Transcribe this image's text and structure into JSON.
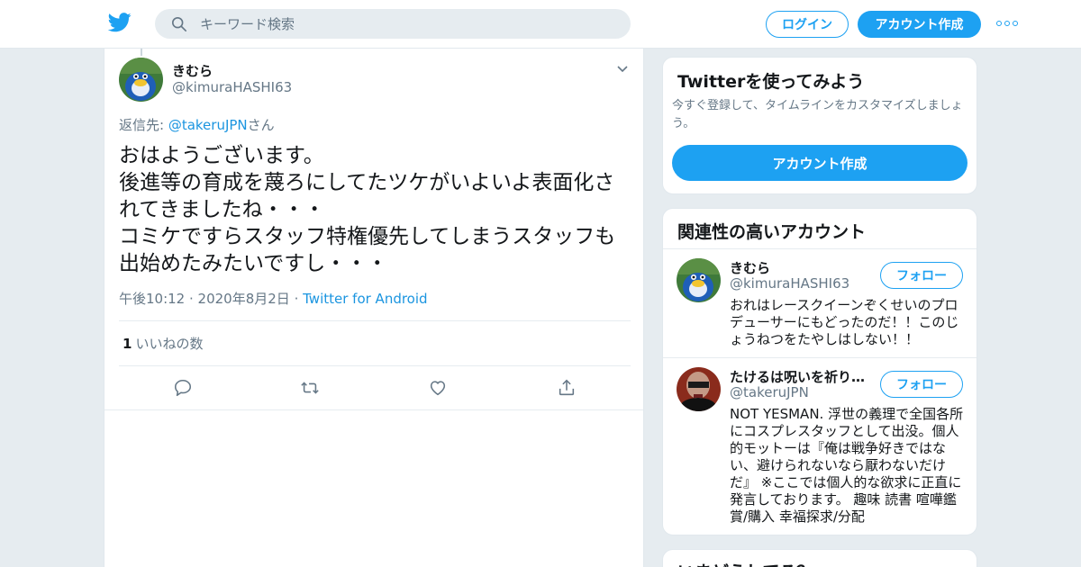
{
  "header": {
    "search_placeholder": "キーワード検索",
    "login_label": "ログイン",
    "signup_label": "アカウント作成",
    "brand_color": "#1da1f2",
    "icons": [
      "twitter-bird-icon",
      "search-icon",
      "more-icon"
    ]
  },
  "tweet": {
    "display_name": "きむら",
    "handle": "@kimuraHASHI63",
    "reply_prefix": "返信先: ",
    "reply_mention": "@takeruJPN",
    "reply_suffix": "さん",
    "text": "おはようございます。\n後進等の育成を蔑ろにしてたツケがいよいよ表面化されてきましたね・・・\nコミケですらスタッフ特権優先してしまうスタッフも出始めたみたいですし・・・",
    "time": "午後10:12",
    "date": "2020年8月2日",
    "source": "Twitter for Android",
    "like_count": "1",
    "like_label": "いいねの数",
    "actions": [
      "reply-icon",
      "retweet-icon",
      "like-icon",
      "share-icon"
    ]
  },
  "signup_card": {
    "title": "Twitterを使ってみよう",
    "description": "今すぐ登録して、タイムラインをカスタマイズしましょう。",
    "button_label": "アカウント作成"
  },
  "related": {
    "title": "関連性の高いアカウント",
    "accounts": [
      {
        "name": "きむら",
        "handle": "@kimuraHASHI63",
        "bio": "おれはレースクイーンぞくせいのプロデューサーにもどったのだ！！このじょうねつをたやしはしない！！",
        "follow_label": "フォロー"
      },
      {
        "name": "たけるは呪いを祈り…",
        "handle": "@takeruJPN",
        "bio": "NOT YESMAN. 浮世の義理で全国各所にコスプレスタッフとして出没。個人的モットーは『俺は戦争好きではない、避けられないなら厭わないだけだ』 ※ここでは個人的な欲求に正直に発言しております。 趣味 読書 喧嘩鑑賞/購入 幸福探求/分配",
        "follow_label": "フォロー"
      }
    ]
  },
  "peek_card": {
    "title": "いまどうしてる？"
  }
}
